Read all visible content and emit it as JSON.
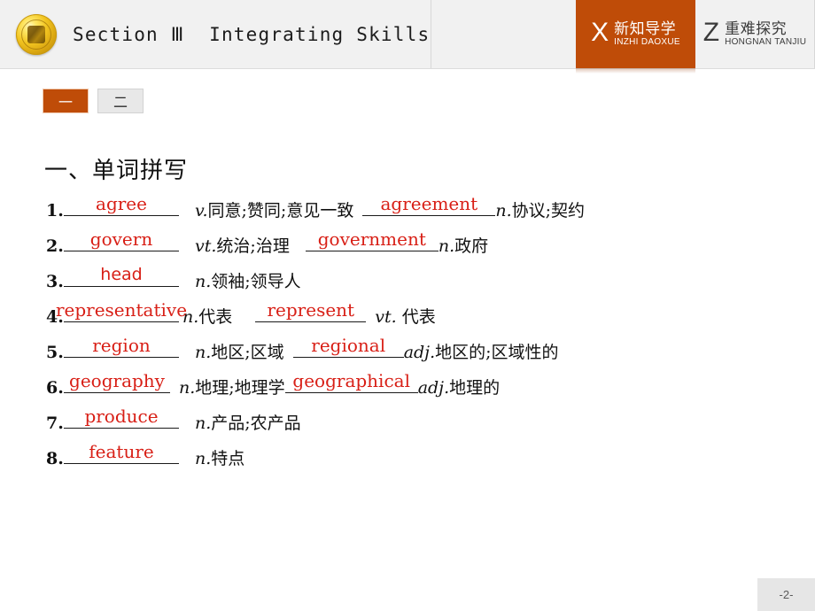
{
  "header": {
    "logo_name": "gold-medallion-logo",
    "title": "Section Ⅲ  Integrating Skills",
    "tabs": [
      {
        "letter": "X",
        "cn": "新知导学",
        "pinyin": "INZHI DAOXUE",
        "state": "active",
        "accent": "#bf4c08"
      },
      {
        "letter": "Z",
        "cn": "重难探究",
        "pinyin": "HONGNAN TANJIU",
        "state": "inactive",
        "accent": "#f1f1f1"
      }
    ]
  },
  "subtabs": [
    {
      "label": "一",
      "selected": true
    },
    {
      "label": "二",
      "selected": false
    }
  ],
  "content": {
    "section_heading": "一、单词拼写",
    "answer_color": "#d81f16",
    "items": [
      {
        "num": "1.",
        "answer1": "agree",
        "gloss1_pos": "v.",
        "gloss1_text": "同意;赞同;意见一致",
        "answer2": "agreement",
        "gloss2_pos": "n.",
        "gloss2_text": "协议;契约"
      },
      {
        "num": "2.",
        "answer1": "govern",
        "gloss1_pos": "vt.",
        "gloss1_text": "统治;治理",
        "answer2": "government",
        "gloss2_pos": "n.",
        "gloss2_text": "政府"
      },
      {
        "num": "3.",
        "answer1": "head",
        "gloss1_pos": "n.",
        "gloss1_text": "领袖;领导人",
        "answer2": "",
        "gloss2_pos": "",
        "gloss2_text": ""
      },
      {
        "num": "4.",
        "answer1": "representative",
        "gloss1_pos": "n.",
        "gloss1_text": "代表",
        "answer2": "represent",
        "gloss2_pos": "vt.",
        "gloss2_text": " 代表"
      },
      {
        "num": "5.",
        "answer1": "region",
        "gloss1_pos": "n.",
        "gloss1_text": "地区;区域",
        "answer2": "regional",
        "gloss2_pos": "adj.",
        "gloss2_text": "地区的;区域性的"
      },
      {
        "num": "6.",
        "answer1": "geography",
        "gloss1_pos": "n.",
        "gloss1_text": "地理;地理学",
        "answer2": "geographical",
        "gloss2_pos": "adj.",
        "gloss2_text": "地理的"
      },
      {
        "num": "7.",
        "answer1": "produce",
        "gloss1_pos": "n.",
        "gloss1_text": "产品;农产品",
        "answer2": "",
        "gloss2_pos": "",
        "gloss2_text": ""
      },
      {
        "num": "8.",
        "answer1": "feature",
        "gloss1_pos": "n.",
        "gloss1_text": "特点",
        "answer2": "",
        "gloss2_pos": "",
        "gloss2_text": ""
      }
    ]
  },
  "footer": {
    "page_label": "-2-"
  }
}
